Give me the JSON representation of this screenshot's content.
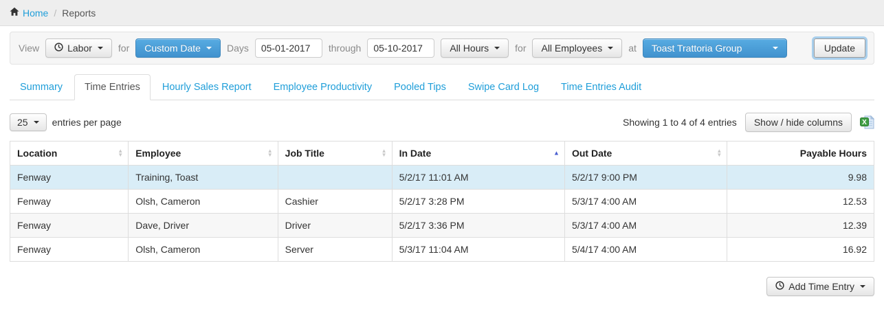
{
  "breadcrumb": {
    "home": "Home",
    "separator": "/",
    "current": "Reports"
  },
  "filter_bar": {
    "view_label": "View",
    "view_button": "Labor",
    "for_label_1": "for",
    "date_range_button": "Custom Date",
    "days_label": "Days",
    "start_date": "05-01-2017",
    "through_label": "through",
    "end_date": "05-10-2017",
    "hours_button": "All Hours",
    "for_label_2": "for",
    "employees_button": "All Employees",
    "at_label": "at",
    "location_select_value": "Toast Trattoria Group",
    "update_button": "Update"
  },
  "tabs": [
    {
      "label": "Summary",
      "active": false
    },
    {
      "label": "Time Entries",
      "active": true
    },
    {
      "label": "Hourly Sales Report",
      "active": false
    },
    {
      "label": "Employee Productivity",
      "active": false
    },
    {
      "label": "Pooled Tips",
      "active": false
    },
    {
      "label": "Swipe Card Log",
      "active": false
    },
    {
      "label": "Time Entries Audit",
      "active": false
    }
  ],
  "table_controls": {
    "page_size": "25",
    "entries_per_page_label": "entries per page",
    "showing_text": "Showing 1 to 4 of 4 entries",
    "show_hide_button": "Show / hide columns",
    "export_icon": "excel-export-icon"
  },
  "table": {
    "columns": [
      {
        "label": "Location",
        "sort": "both"
      },
      {
        "label": "Employee",
        "sort": "both"
      },
      {
        "label": "Job Title",
        "sort": "both"
      },
      {
        "label": "In Date",
        "sort": "asc"
      },
      {
        "label": "Out Date",
        "sort": "both"
      },
      {
        "label": "Payable Hours",
        "sort": "none",
        "align": "right"
      }
    ],
    "rows": [
      {
        "cells": [
          "Fenway",
          "Training, Toast",
          "",
          "5/2/17 11:01 AM",
          "5/2/17 9:00 PM",
          "9.98"
        ],
        "highlighted": true
      },
      {
        "cells": [
          "Fenway",
          "Olsh, Cameron",
          "Cashier",
          "5/2/17 3:28 PM",
          "5/3/17 4:00 AM",
          "12.53"
        ],
        "highlighted": false
      },
      {
        "cells": [
          "Fenway",
          "Dave, Driver",
          "Driver",
          "5/2/17 3:36 PM",
          "5/3/17 4:00 AM",
          "12.39"
        ],
        "highlighted": false
      },
      {
        "cells": [
          "Fenway",
          "Olsh, Cameron",
          "Server",
          "5/3/17 11:04 AM",
          "5/4/17 4:00 AM",
          "16.92"
        ],
        "highlighted": false
      }
    ]
  },
  "footer": {
    "add_time_entry_button": "Add Time Entry"
  },
  "colors": {
    "link_blue": "#1f9ed9",
    "button_blue_top": "#57abe2",
    "button_blue_bottom": "#4192ce",
    "row_highlight": "#d9edf7",
    "row_stripe": "#f7f7f7",
    "table_border": "#dddddd",
    "topbar_bg": "#eeeeee",
    "panel_bg": "#f6f6f6",
    "sort_active": "#4a5fd0"
  }
}
